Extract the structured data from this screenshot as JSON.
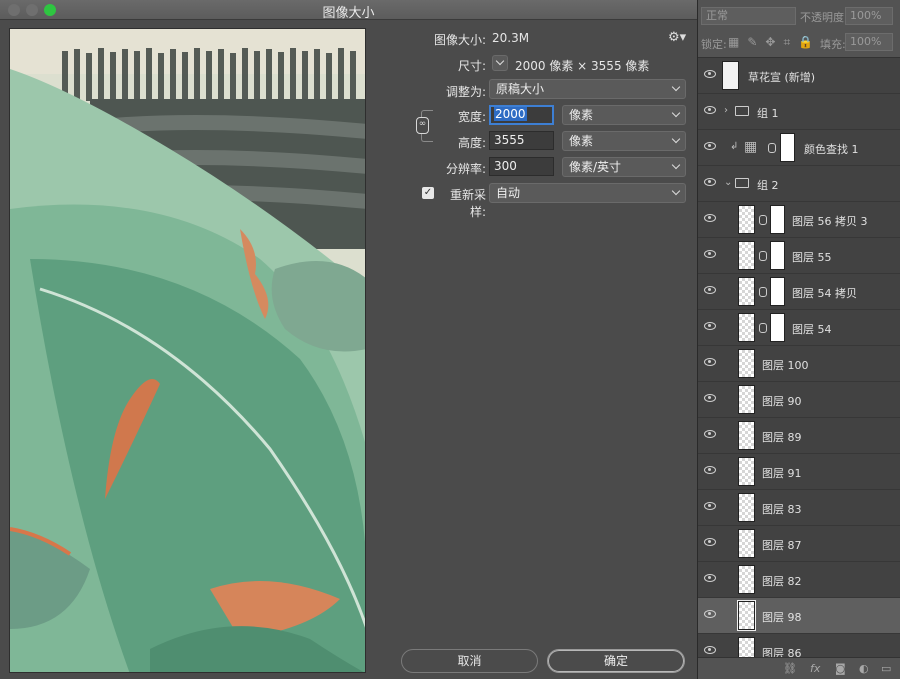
{
  "dialog": {
    "title": "图像大小",
    "gear_icon": "gear-icon",
    "image_size_label": "图像大小:",
    "image_size_value": "20.3M",
    "dimensions_label": "尺寸:",
    "dimensions_value": "2000 像素 × 3555 像素",
    "fit_to_label": "调整为:",
    "fit_to_value": "原稿大小",
    "width_label": "宽度:",
    "width_value": "2000",
    "width_unit": "像素",
    "height_label": "高度:",
    "height_value": "3555",
    "height_unit": "像素",
    "resolution_label": "分辨率:",
    "resolution_value": "300",
    "resolution_unit": "像素/英寸",
    "resample_label": "重新采样:",
    "resample_checked": true,
    "resample_value": "自动",
    "cancel_label": "取消",
    "ok_label": "确定"
  },
  "layers_panel": {
    "blend_mode": "正常",
    "opacity_label": "不透明度:",
    "opacity_value": "100%",
    "lock_label": "锁定:",
    "fill_label": "填充:",
    "fill_value": "100%",
    "layers": [
      {
        "name": "草花宣 (新增)",
        "kind": "solid"
      },
      {
        "name": "组 1",
        "kind": "group-collapsed"
      },
      {
        "name": "颜色查找 1",
        "kind": "adjustment"
      },
      {
        "name": "组 2",
        "kind": "group-expanded"
      },
      {
        "name": "图层 56 拷贝 3",
        "kind": "masked"
      },
      {
        "name": "图层 55",
        "kind": "masked"
      },
      {
        "name": "图层 54 拷贝",
        "kind": "masked"
      },
      {
        "name": "图层 54",
        "kind": "masked"
      },
      {
        "name": "图层 100",
        "kind": "pixel"
      },
      {
        "name": "图层 90",
        "kind": "pixel"
      },
      {
        "name": "图层 89",
        "kind": "pixel"
      },
      {
        "name": "图层 91",
        "kind": "pixel"
      },
      {
        "name": "图层 83",
        "kind": "pixel"
      },
      {
        "name": "图层 87",
        "kind": "pixel"
      },
      {
        "name": "图层 82",
        "kind": "pixel"
      },
      {
        "name": "图层 98",
        "kind": "pixel",
        "selected": true
      },
      {
        "name": "图层 86",
        "kind": "pixel"
      }
    ],
    "footer_icons": [
      "link-icon",
      "fx-icon",
      "mask-icon",
      "adjustment-icon",
      "folder-icon"
    ]
  }
}
